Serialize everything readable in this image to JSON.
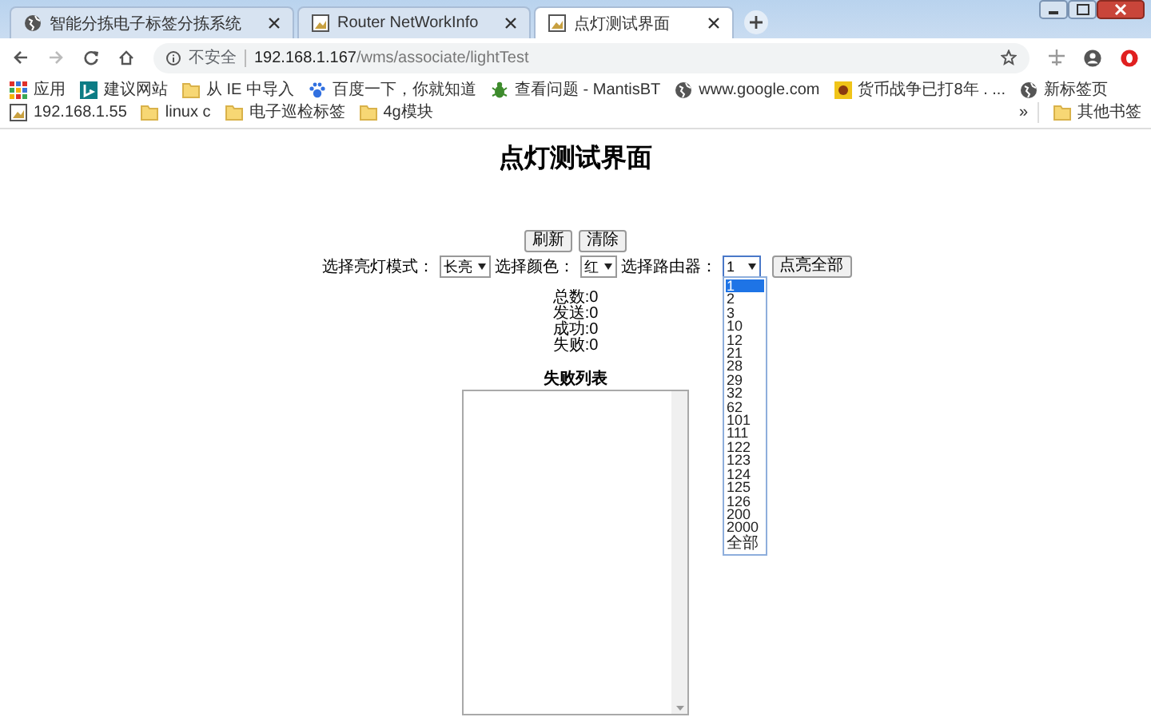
{
  "tabs": [
    {
      "title": "智能分拣电子标签分拣系统",
      "kind": "globe",
      "selected": false
    },
    {
      "title": "Router NetWorkInfo",
      "kind": "image",
      "selected": false
    },
    {
      "title": "点灯测试界面",
      "kind": "image",
      "selected": true
    }
  ],
  "address_bar": {
    "security": "不安全",
    "host": "192.168.1.167",
    "path": "/wms/associate/lightTest"
  },
  "bookmarks": [
    {
      "label": "应用",
      "kind": "apps"
    },
    {
      "label": "建议网站",
      "kind": "bing"
    },
    {
      "label": "从 IE 中导入",
      "kind": "folder"
    },
    {
      "label": "百度一下，你就知道",
      "kind": "paw"
    },
    {
      "label": "查看问题 - MantisBT",
      "kind": "bug"
    },
    {
      "label": "www.google.com",
      "kind": "globe"
    },
    {
      "label": "货币战争已打8年 . ...",
      "kind": "coin"
    },
    {
      "label": "新标签页",
      "kind": "globe"
    },
    {
      "label": "192.168.1.55",
      "kind": "image"
    },
    {
      "label": "linux c",
      "kind": "folder"
    },
    {
      "label": "电子巡检标签",
      "kind": "folder"
    },
    {
      "label": "4g模块",
      "kind": "folder"
    },
    {
      "label": "»",
      "kind": "more"
    },
    {
      "label": "其他书签",
      "kind": "folder"
    }
  ],
  "page": {
    "title": "点灯测试界面",
    "buttons": [
      "刷新",
      "清除"
    ],
    "mode": {
      "label": "选择亮灯模式：",
      "value": "长亮"
    },
    "color": {
      "label": "选择颜色：",
      "value": "红"
    },
    "router": {
      "label": "选择路由器：",
      "value": "1",
      "expanded": true,
      "options": [
        {
          "label": "1",
          "selected": true
        },
        {
          "label": "2",
          "selected": false
        },
        {
          "label": "3",
          "selected": false
        },
        {
          "label": "10",
          "selected": false
        },
        {
          "label": "12",
          "selected": false
        },
        {
          "label": "21",
          "selected": false
        },
        {
          "label": "28",
          "selected": false
        },
        {
          "label": "29",
          "selected": false
        },
        {
          "label": "32",
          "selected": false
        },
        {
          "label": "62",
          "selected": false
        },
        {
          "label": "101",
          "selected": false
        },
        {
          "label": "111",
          "selected": false
        },
        {
          "label": "122",
          "selected": false
        },
        {
          "label": "123",
          "selected": false
        },
        {
          "label": "124",
          "selected": false
        },
        {
          "label": "125",
          "selected": false
        },
        {
          "label": "126",
          "selected": false
        },
        {
          "label": "200",
          "selected": false
        },
        {
          "label": "2000",
          "selected": false
        },
        {
          "label": "全部",
          "selected": false
        }
      ]
    },
    "light_all_button": "点亮全部",
    "stats": [
      "总数:0",
      "发送:0",
      "成功:0",
      "失败:0"
    ],
    "fail_list": {
      "title": "失败列表"
    }
  }
}
